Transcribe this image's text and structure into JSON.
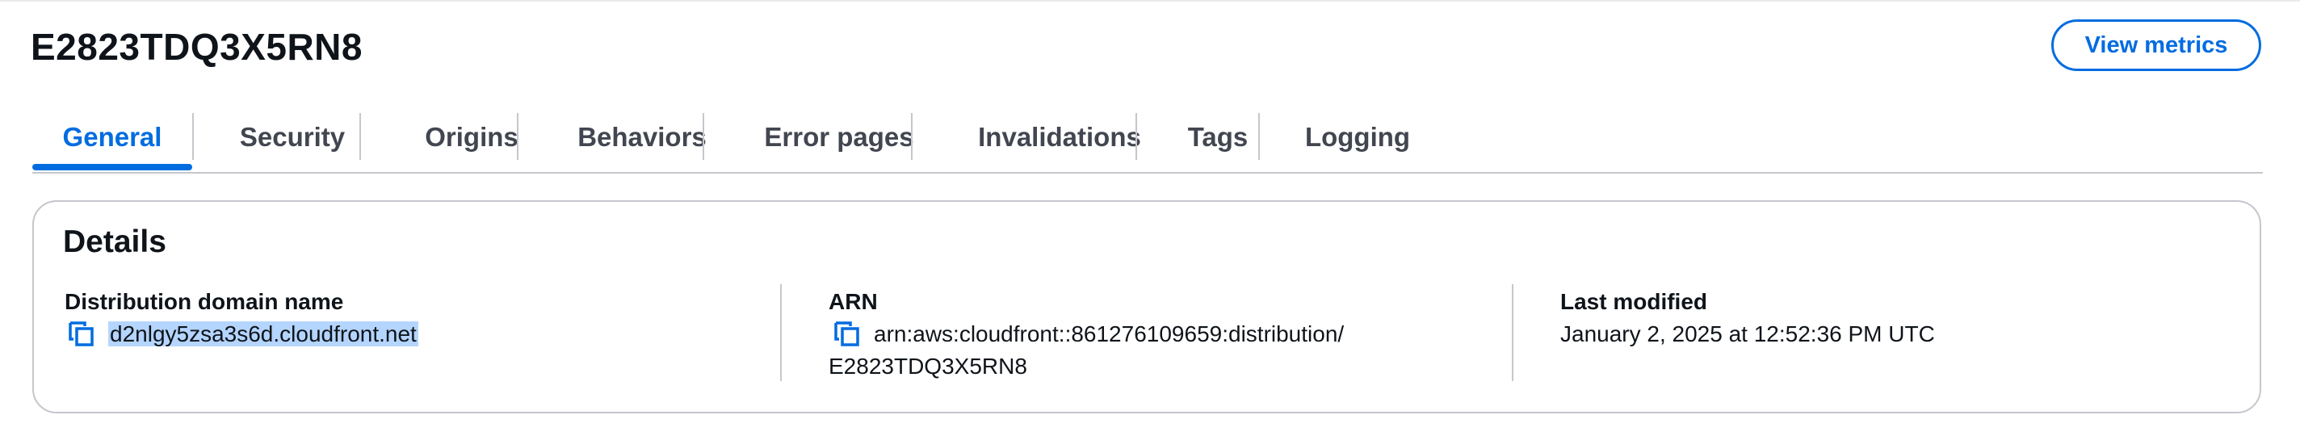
{
  "header": {
    "title": "E2823TDQ3X5RN8",
    "view_metrics_label": "View metrics"
  },
  "tabs": [
    {
      "label": "General",
      "active": true
    },
    {
      "label": "Security"
    },
    {
      "label": "Origins"
    },
    {
      "label": "Behaviors"
    },
    {
      "label": "Error pages"
    },
    {
      "label": "Invalidations"
    },
    {
      "label": "Tags"
    },
    {
      "label": "Logging"
    }
  ],
  "details": {
    "title": "Details",
    "domain": {
      "label": "Distribution domain name",
      "value": "d2nlgy5zsa3s6d.cloudfront.net"
    },
    "arn": {
      "label": "ARN",
      "value_line1": "arn:aws:cloudfront::861276109659:distribution/",
      "value_line2": "E2823TDQ3X5RN8"
    },
    "modified": {
      "label": "Last modified",
      "value": "January 2, 2025 at 12:52:36 PM UTC"
    }
  },
  "colors": {
    "accent": "#006ce0",
    "text": "#0f141a",
    "tab_text": "#424650",
    "border": "#c6c6cd",
    "selection": "#b4d5fe"
  },
  "icons": {
    "copy": "copy-icon"
  }
}
